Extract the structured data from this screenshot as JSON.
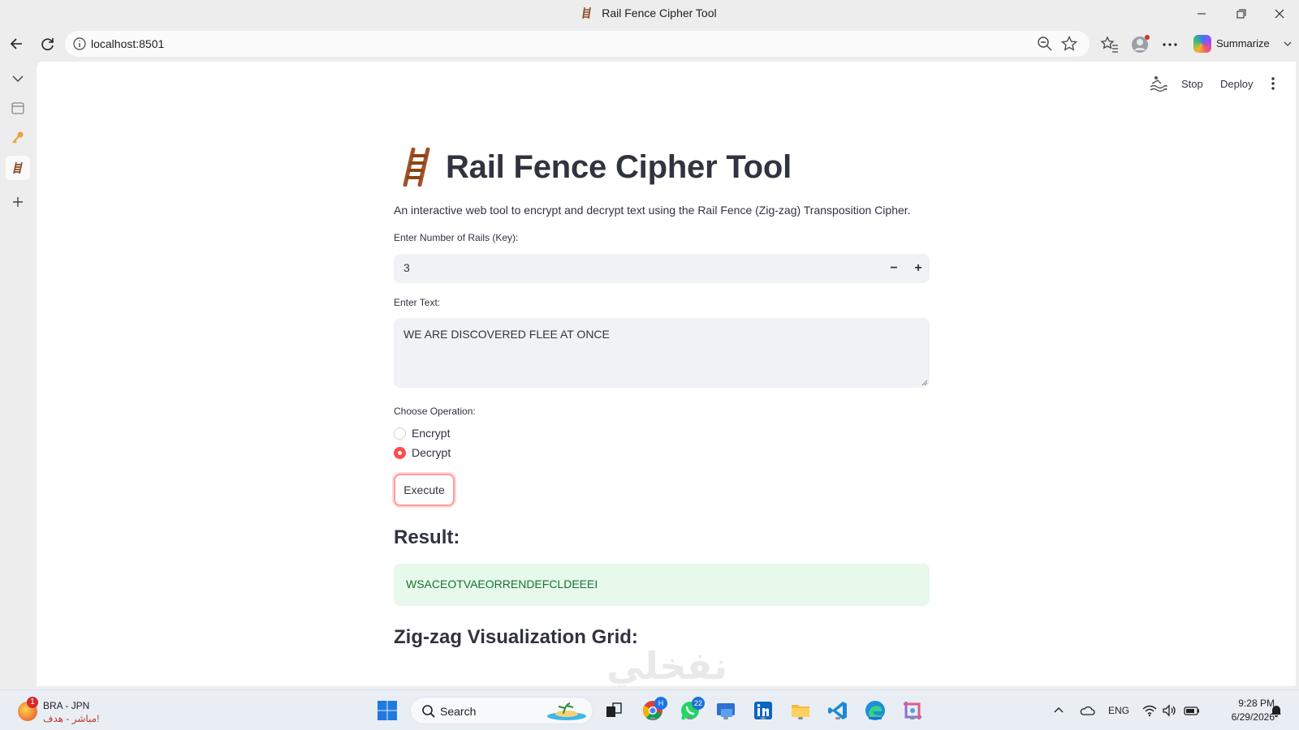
{
  "window": {
    "title": "Rail Fence Cipher Tool"
  },
  "browser": {
    "url": "localhost:8501",
    "summarize_label": "Summarize"
  },
  "app_toolbar": {
    "stop_label": "Stop",
    "deploy_label": "Deploy"
  },
  "main": {
    "title": "Rail Fence Cipher Tool",
    "description": "An interactive web tool to encrypt and decrypt text using the Rail Fence (Zig-zag) Transposition Cipher.",
    "rails_label": "Enter Number of Rails (Key):",
    "rails_value": "3",
    "text_label": "Enter Text:",
    "text_value": "WE ARE DISCOVERED FLEE AT ONCE",
    "operation_label": "Choose Operation:",
    "operations": [
      {
        "label": "Encrypt",
        "selected": false
      },
      {
        "label": "Decrypt",
        "selected": true
      }
    ],
    "execute_label": "Execute",
    "result_heading": "Result:",
    "result_value": "WSACEOTVAEORRENDEFCLDEEEI",
    "viz_heading": "Zig-zag Visualization Grid:",
    "watermark": "نفخلي"
  },
  "taskbar": {
    "news_badge": "1",
    "news_title": "BRA - JPN",
    "news_subtitle": "مباشر - هدف!",
    "search_label": "Search",
    "chrome_badge": "H",
    "whatsapp_badge": "22",
    "language": "ENG",
    "time": "9:28 PM",
    "date": "6/29/2026"
  },
  "colors": {
    "accent": "#ff4b4b",
    "result_bg": "#e6f9ea",
    "result_text": "#177233"
  }
}
